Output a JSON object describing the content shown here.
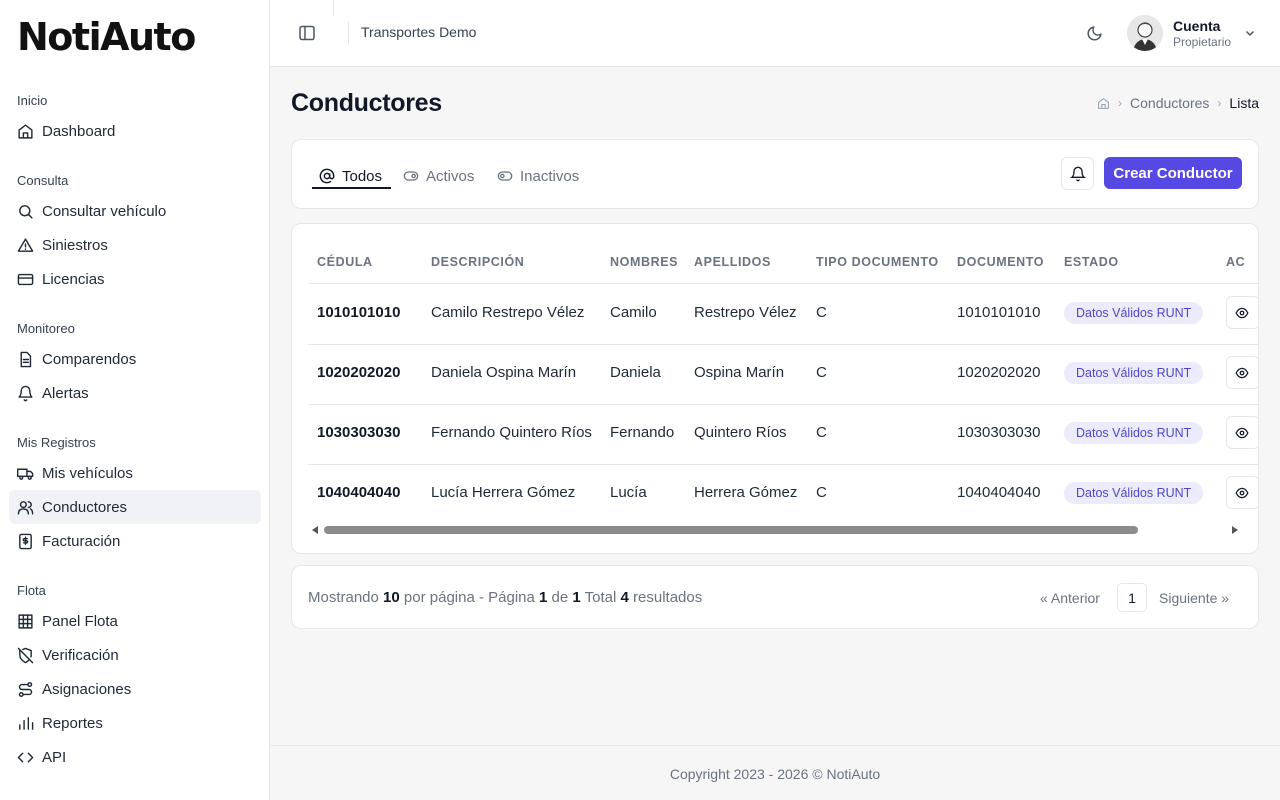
{
  "app": {
    "logo": "NotiAuto",
    "company": "Transportes Demo"
  },
  "account": {
    "name": "Cuenta",
    "role": "Propietario"
  },
  "sidebar": {
    "sections": [
      {
        "title": "Inicio",
        "items": [
          {
            "label": "Dashboard",
            "icon": "home-icon"
          }
        ]
      },
      {
        "title": "Consulta",
        "items": [
          {
            "label": "Consultar vehículo",
            "icon": "search-icon"
          },
          {
            "label": "Siniestros",
            "icon": "warning-icon"
          },
          {
            "label": "Licencias",
            "icon": "card-icon"
          }
        ]
      },
      {
        "title": "Monitoreo",
        "items": [
          {
            "label": "Comparendos",
            "icon": "document-icon"
          },
          {
            "label": "Alertas",
            "icon": "bell-icon"
          }
        ]
      },
      {
        "title": "Mis Registros",
        "items": [
          {
            "label": "Mis vehículos",
            "icon": "truck-icon"
          },
          {
            "label": "Conductores",
            "icon": "users-icon",
            "active": true
          },
          {
            "label": "Facturación",
            "icon": "receipt-icon"
          }
        ]
      },
      {
        "title": "Flota",
        "items": [
          {
            "label": "Panel Flota",
            "icon": "grid-icon"
          },
          {
            "label": "Verificación",
            "icon": "shield-off-icon"
          },
          {
            "label": "Asignaciones",
            "icon": "route-icon"
          },
          {
            "label": "Reportes",
            "icon": "bar-chart-icon"
          },
          {
            "label": "API",
            "icon": "code-icon"
          }
        ]
      }
    ]
  },
  "page": {
    "title": "Conductores",
    "breadcrumb": {
      "section": "Conductores",
      "current": "Lista"
    }
  },
  "tabs": [
    {
      "label": "Todos",
      "icon": "at-icon",
      "active": true
    },
    {
      "label": "Activos",
      "icon": "toggle-on-icon"
    },
    {
      "label": "Inactivos",
      "icon": "toggle-off-icon"
    }
  ],
  "actions": {
    "create_label": "Crear Conductor"
  },
  "table": {
    "columns": [
      "CÉDULA",
      "DESCRIPCIÓN",
      "NOMBRES",
      "APELLIDOS",
      "TIPO DOCUMENTO",
      "DOCUMENTO",
      "ESTADO",
      "AC"
    ],
    "rows": [
      {
        "cedula": "1010101010",
        "descripcion": "Camilo Restrepo Vélez",
        "nombres": "Camilo",
        "apellidos": "Restrepo Vélez",
        "tipo": "C",
        "documento": "1010101010",
        "estado": "Datos Válidos RUNT"
      },
      {
        "cedula": "1020202020",
        "descripcion": "Daniela Ospina Marín",
        "nombres": "Daniela",
        "apellidos": "Ospina Marín",
        "tipo": "C",
        "documento": "1020202020",
        "estado": "Datos Válidos RUNT"
      },
      {
        "cedula": "1030303030",
        "descripcion": "Fernando Quintero Ríos",
        "nombres": "Fernando",
        "apellidos": "Quintero Ríos",
        "tipo": "C",
        "documento": "1030303030",
        "estado": "Datos Válidos RUNT"
      },
      {
        "cedula": "1040404040",
        "descripcion": "Lucía Herrera Gómez",
        "nombres": "Lucía",
        "apellidos": "Herrera Gómez",
        "tipo": "C",
        "documento": "1040404040",
        "estado": "Datos Válidos RUNT"
      }
    ]
  },
  "pagination": {
    "text_showing": "Mostrando",
    "per_page": "10",
    "text_per_page": "por página - Página",
    "page": "1",
    "text_of": "de",
    "pages": "1",
    "text_total": "Total",
    "total": "4",
    "text_results": "resultados",
    "prev_label": "« Anterior",
    "current_page": "1",
    "next_label": "Siguiente »"
  },
  "footer": {
    "copyright": "Copyright 2023 - 2026 © NotiAuto"
  },
  "colors": {
    "accent": "#5548e3",
    "badge_bg": "#ecebfb",
    "badge_text": "#5047c7"
  }
}
